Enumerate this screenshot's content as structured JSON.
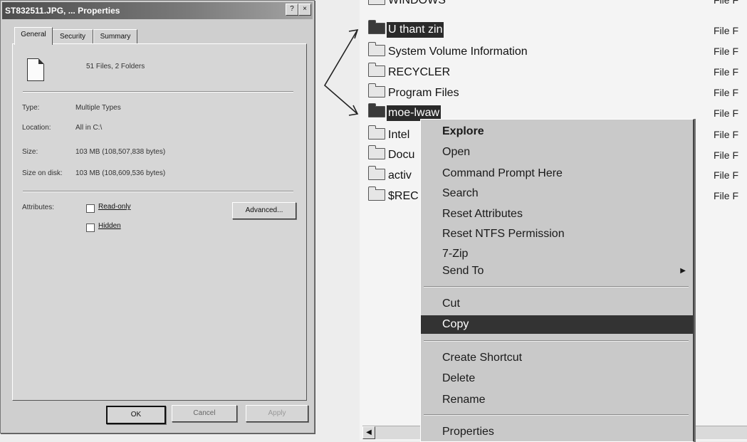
{
  "dialog": {
    "title": "ST832511.JPG, ... Properties",
    "help_btn": "?",
    "close_btn": "×",
    "tabs": [
      "General",
      "Security",
      "Summary"
    ],
    "summary": "51 Files, 2 Folders",
    "fields": [
      {
        "label": "Type:",
        "value": "Multiple Types"
      },
      {
        "label": "Location:",
        "value": "All in C:\\"
      },
      {
        "label": "Size:",
        "value": "103 MB (108,507,838 bytes)"
      },
      {
        "label": "Size on disk:",
        "value": "103 MB (108,609,536 bytes)"
      }
    ],
    "attributes_label": "Attributes:",
    "readonly_label": "Read-only",
    "hidden_label": "Hidden",
    "advanced_label": "Advanced...",
    "ok_label": "OK",
    "cancel_label": "Cancel",
    "apply_label": "Apply"
  },
  "explorer": {
    "rows": [
      {
        "name": "WINDOWS",
        "type": "File F"
      },
      {
        "name": "U thant zin",
        "type": "File F"
      },
      {
        "name": "System Volume Information",
        "type": "File F"
      },
      {
        "name": "RECYCLER",
        "type": "File F"
      },
      {
        "name": "Program Files",
        "type": "File F"
      },
      {
        "name": "moe-lwaw",
        "type": "File F"
      },
      {
        "name": "Intel",
        "type": "File F"
      },
      {
        "name": "Docu",
        "type": "File F"
      },
      {
        "name": "activ",
        "type": "File F"
      },
      {
        "name": "$REC",
        "type": "File F"
      }
    ],
    "scroll_left": "◀"
  },
  "context_menu": {
    "items": [
      "Explore",
      "Open",
      "Command Prompt Here",
      "Search",
      "Reset Attributes",
      "Reset NTFS Permission",
      "7-Zip",
      "Send To",
      "Cut",
      "Copy",
      "Create Shortcut",
      "Delete",
      "Rename",
      "Properties"
    ],
    "submenu_arrow": "▶"
  }
}
